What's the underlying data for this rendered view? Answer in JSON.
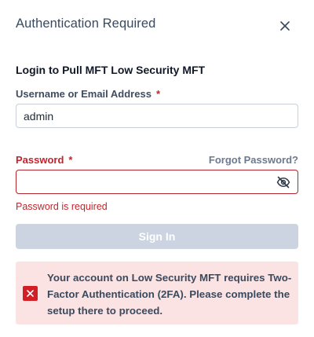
{
  "dialog": {
    "title": "Authentication Required",
    "close_icon": "close-icon",
    "subtitle": "Login to Pull MFT Low Security MFT"
  },
  "username": {
    "label": "Username or Email Address",
    "required_marker": "*",
    "value": "admin"
  },
  "password": {
    "label": "Password",
    "required_marker": "*",
    "forgot_link": "Forgot Password?",
    "value": "",
    "toggle_icon": "eye-off-icon",
    "error": "Password is required"
  },
  "signin": {
    "label": "Sign In",
    "disabled": true
  },
  "alert": {
    "icon": "error-x-icon",
    "message": "Your account on Low Security MFT requires Two-Factor Authentication (2FA). Please complete the setup there to proceed."
  },
  "colors": {
    "error": "#c0262d",
    "alert_bg": "#fbe3e3",
    "alert_icon_bg": "#d21f26",
    "button_disabled": "#cbd4e0",
    "heading": "#3a4a5e"
  }
}
